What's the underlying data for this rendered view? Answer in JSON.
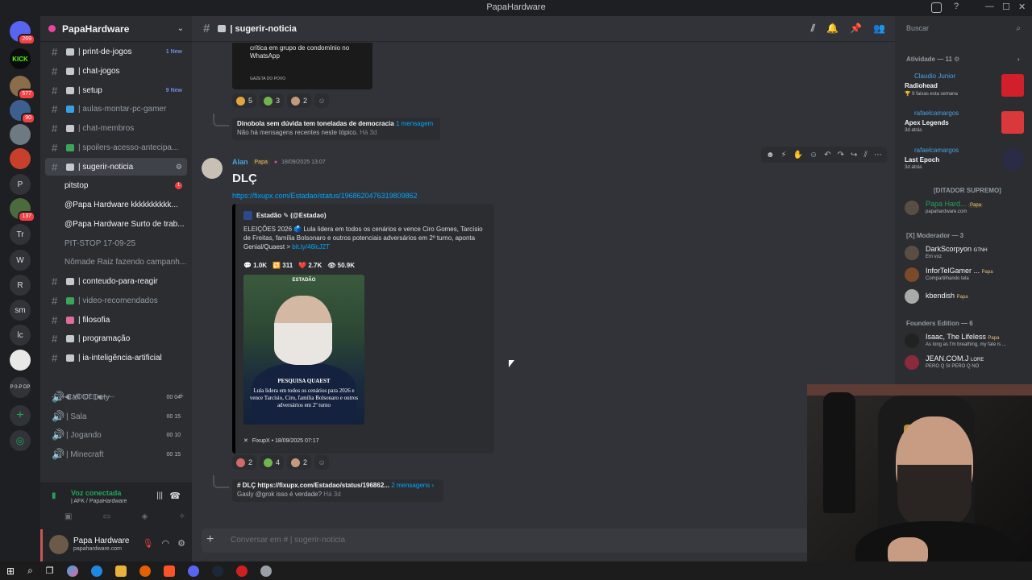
{
  "window": {
    "title": "PapaHardware"
  },
  "rail": {
    "servers": [
      {
        "label": "",
        "badge": "269"
      },
      {
        "label": "KICK",
        "badge": ""
      },
      {
        "label": "",
        "badge": "577"
      },
      {
        "label": "",
        "badge": "90"
      },
      {
        "label": "",
        "badge": ""
      },
      {
        "label": "",
        "badge": ""
      },
      {
        "label": "P",
        "badge": ""
      },
      {
        "label": "",
        "badge": "137"
      },
      {
        "label": "Tr",
        "badge": ""
      },
      {
        "label": "W",
        "badge": ""
      },
      {
        "label": "R",
        "badge": ""
      },
      {
        "label": "sm",
        "badge": ""
      },
      {
        "label": "lc",
        "badge": ""
      },
      {
        "label": "",
        "badge": ""
      },
      {
        "label": "P 0-P DP",
        "badge": ""
      }
    ]
  },
  "sidebar": {
    "guild_name": "PapaHardware",
    "channels": [
      {
        "name": "| print-de-jogos",
        "new": "1 New",
        "badge": ""
      },
      {
        "name": "| chat-jogos",
        "new": "",
        "badge": ""
      },
      {
        "name": "| setup",
        "new": "9 New",
        "badge": ""
      },
      {
        "name": "| aulas-montar-pc-gamer",
        "new": "",
        "badge": ""
      },
      {
        "name": "| chat-membros",
        "new": "",
        "badge": ""
      },
      {
        "name": "| spoilers-acesso-antecipa...",
        "new": "",
        "badge": ""
      },
      {
        "name": "| sugerir-noticia",
        "new": "",
        "badge": ""
      },
      {
        "name": "pitstop",
        "new": "",
        "badge": "1"
      },
      {
        "name": "@Papa Hardware kkkkkkkkkk...",
        "new": "",
        "badge": ""
      },
      {
        "name": "@Papa Hardware Surto de trab...",
        "new": "",
        "badge": ""
      },
      {
        "name": "PIT-STOP 17-09-25",
        "new": "",
        "badge": ""
      },
      {
        "name": "Nômade Raiz fazendo campanh...",
        "new": "",
        "badge": ""
      },
      {
        "name": "| conteudo-para-reagir",
        "new": "",
        "badge": ""
      },
      {
        "name": "| video-recomendados",
        "new": "",
        "badge": ""
      },
      {
        "name": "| filosofia",
        "new": "",
        "badge": ""
      },
      {
        "name": "| programação",
        "new": "",
        "badge": ""
      },
      {
        "name": "| ia-inteligência-artificial",
        "new": "",
        "badge": ""
      }
    ],
    "voice_category": "——◀| VOICE |◀——",
    "voice_channels": [
      {
        "name": "Call Of Duty",
        "count": "00  04"
      },
      {
        "name": "| Sala",
        "count": "00  15"
      },
      {
        "name": "| Jogando",
        "count": "00  10"
      },
      {
        "name": "| Minecraft",
        "count": "00  15"
      }
    ],
    "voice_status": {
      "title": "Voz conectada",
      "subtitle": "| AFK / PapaHardware"
    },
    "user": {
      "name": "Papa Hardware",
      "status": "papahardware.com"
    }
  },
  "channel": {
    "name": "| sugerir-noticia",
    "composer_placeholder": "Conversar em #  | sugerir-noticia"
  },
  "messages": {
    "prev_embed_text": "crítica em grupo de condomínio no WhatsApp",
    "prev_embed_source": "GAZETA DO POVO",
    "prev_reactions": [
      "5",
      "3",
      "2"
    ],
    "prev_thread": {
      "title": "Dinobola sem dúvida tem toneladas de democracia",
      "count": "1 mensagem ›",
      "sub": "Não há mensagens recentes neste tópico.",
      "time": "Há 3d"
    },
    "author": "Alan",
    "author_tag": "Papa",
    "timestamp": "18/09/2025 13:07",
    "title": "DLÇ",
    "link": "https://fixupx.com/Estadao/status/1968620476319809862",
    "embed": {
      "author": "Estadão ✎ (@Estadao)",
      "description": "ELEIÇÕES 2026 🗳️ Lula lidera em todos os cenários e vence Ciro Gomes, Tarcísio de Freitas, família Bolsonaro e outros potenciais adversários em 2º turno, aponta Genial/Quaest > ",
      "desc_link": "bit.ly/46lcJ2T",
      "stats": [
        "💬 1.0K",
        "🔁 311",
        "❤️ 2.7K",
        "👁 50.9K"
      ],
      "image_brand": "ESTADÃO",
      "image_caption1": "PESQUISA QUAEST",
      "image_caption2": "Lula lidera em todos os cenários para 2026 e vence Tarcísio, Ciro, família Bolsonaro e outros adversários em 2º turno",
      "footer": "FixupX • 18/09/2025 07:17"
    },
    "reactions": [
      "2",
      "4",
      "2"
    ],
    "thread": {
      "title": "# DLÇ https://fixupx.com/Estadao/status/196862...",
      "count": "2 mensagens ›",
      "sub": "Gasly @grok isso é verdade?",
      "time": "Há 3d"
    }
  },
  "right_panel": {
    "search_placeholder": "Buscar",
    "activity_header": "Atividade — 11 ⚙",
    "activities": [
      {
        "user": "Claudio Junior",
        "game": "Radiohead",
        "detail": "🏆 9 faixas esta semana",
        "color": "#d1202c"
      },
      {
        "user": "rafaelcamargos",
        "game": "Apex Legends",
        "detail": "3d atrás",
        "color": "#d9393a"
      },
      {
        "user": "rafaelcamargos",
        "game": "Last Epoch",
        "detail": "3d atrás",
        "color": "#2a2c45"
      }
    ],
    "role1": "[DITADOR SUPREMO]",
    "role1_members": [
      {
        "name": "Papa Hard...",
        "tag": "Papa",
        "sub": "papahardware.com"
      }
    ],
    "role2": "[X]              Moderador        — 3",
    "role2_members": [
      {
        "name": "DarkScorpyon",
        "tag": "GTNH",
        "sub": "Em voz"
      },
      {
        "name": "InforTelGamer ...",
        "tag": "Papa",
        "sub": "Compartilhando tela"
      },
      {
        "name": "kbendish",
        "tag": "Papa",
        "sub": ""
      }
    ],
    "role3": "Founders Edition — 6",
    "role3_members": [
      {
        "name": "Isaac, The Lifeless",
        "tag": "Papa",
        "sub": "As long as I'm breathing, my fate is ..."
      },
      {
        "name": "JEAN.COM.J",
        "tag": "LORE",
        "sub": "PERO Q SI PERO Q NO"
      }
    ]
  },
  "colors": {
    "accent": "#5865f2",
    "link": "#00a8fc",
    "online": "#23a55a",
    "mention": "#f23f43"
  }
}
